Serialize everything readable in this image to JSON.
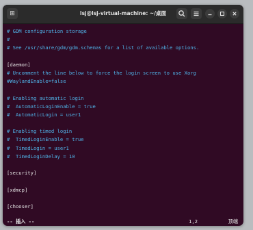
{
  "window": {
    "title": "lsj@lsj-virtual-machine: ~/桌面"
  },
  "icons": {
    "new_tab": "new-tab-icon",
    "search": "search-icon",
    "menu": "hamburger-menu-icon",
    "minimize": "minimize-icon",
    "maximize": "maximize-icon",
    "close": "close-icon"
  },
  "colors": {
    "terminal_background": "#300a24",
    "comment": "#4fb3e8",
    "text": "#e5e5e5",
    "titlebar": "#2b2b2b"
  },
  "editor": {
    "lines": [
      {
        "text": "# GDM configuration storage",
        "kind": "comment"
      },
      {
        "text": "#",
        "kind": "comment"
      },
      {
        "text": "# See /usr/share/gdm/gdm.schemas for a list of available options.",
        "kind": "comment"
      },
      {
        "text": "",
        "kind": "plain"
      },
      {
        "text": "[daemon]",
        "kind": "section"
      },
      {
        "text": "# Uncomment the line below to force the login screen to use Xorg",
        "kind": "comment"
      },
      {
        "text": "#WaylandEnable=false",
        "kind": "comment"
      },
      {
        "text": "",
        "kind": "plain"
      },
      {
        "text": "# Enabling automatic login",
        "kind": "comment"
      },
      {
        "text": "#  AutomaticLoginEnable = true",
        "kind": "comment"
      },
      {
        "text": "#  AutomaticLogin = user1",
        "kind": "comment"
      },
      {
        "text": "",
        "kind": "plain"
      },
      {
        "text": "# Enabling timed login",
        "kind": "comment"
      },
      {
        "text": "#  TimedLoginEnable = true",
        "kind": "comment"
      },
      {
        "text": "#  TimedLogin = user1",
        "kind": "comment"
      },
      {
        "text": "#  TimedLoginDelay = 10",
        "kind": "comment"
      },
      {
        "text": "",
        "kind": "plain"
      },
      {
        "text": "[security]",
        "kind": "section"
      },
      {
        "text": "",
        "kind": "plain"
      },
      {
        "text": "[xdmcp]",
        "kind": "section"
      },
      {
        "text": "",
        "kind": "plain"
      },
      {
        "text": "[chooser]",
        "kind": "section"
      }
    ]
  },
  "statusbar": {
    "mode": "-- 插入 --",
    "cursor_position": "1,2",
    "scroll_location": "顶端"
  }
}
